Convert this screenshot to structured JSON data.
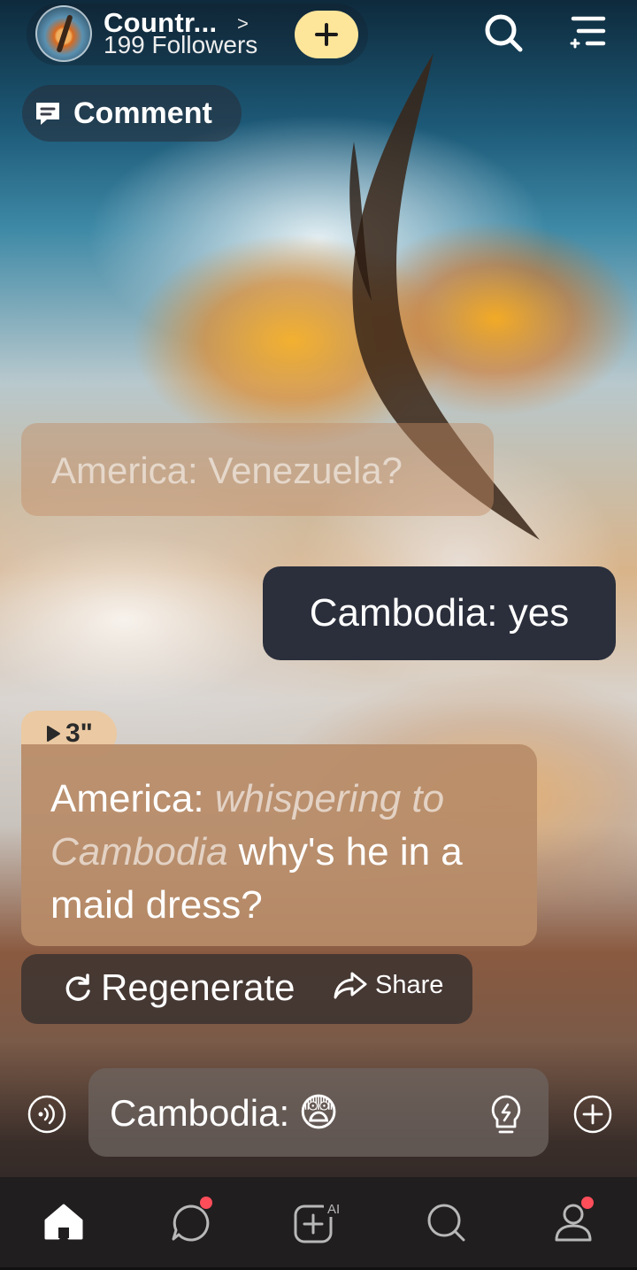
{
  "header": {
    "character_name": "Countr...",
    "chevron": ">",
    "followers": "199 Followers",
    "follow_button": "+",
    "search_icon": "search-icon",
    "menu_icon": "menu-icon"
  },
  "comment_button": {
    "label": "Comment",
    "icon": "comment-icon"
  },
  "messages": [
    {
      "side": "other",
      "text": "America: Venezuela?"
    },
    {
      "side": "self",
      "text": "Cambodia: yes"
    },
    {
      "side": "other",
      "voice_duration": "3\"",
      "speaker": "America:",
      "whisper": "whispering to Cambodia",
      "text": "why's he in a maid dress?"
    }
  ],
  "actions": {
    "regenerate": "Regenerate",
    "share": "Share"
  },
  "input": {
    "value": "Cambodia:",
    "emoji": "😨"
  },
  "bottom_nav": {
    "items": [
      "home-icon",
      "chat-icon",
      "create-ai-icon",
      "discover-icon",
      "profile-icon"
    ],
    "ai_badge": "AI"
  },
  "colors": {
    "follow_button": "#fde59a",
    "user_bubble": "#2b2f3c",
    "ai_bubble": "#b88c68",
    "notification_dot": "#ff4d5a"
  }
}
